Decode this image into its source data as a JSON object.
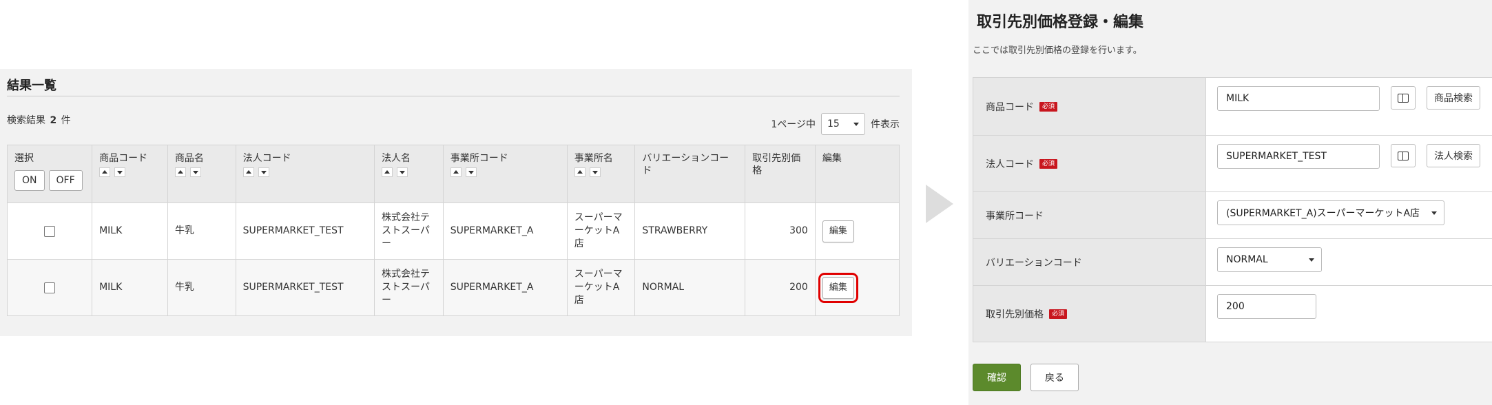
{
  "list": {
    "title": "結果一覧",
    "count_label": "検索結果",
    "count_value": "2",
    "count_unit": "件",
    "per_page_prefix": "1ページ中",
    "per_page_value": "15",
    "per_page_suffix": "件表示",
    "columns": {
      "select": "選択",
      "product_code": "商品コード",
      "product_name": "商品名",
      "corp_code": "法人コード",
      "corp_name": "法人名",
      "office_code": "事業所コード",
      "office_name": "事業所名",
      "variation_code": "バリエーションコード",
      "price": "取引先別価格",
      "edit": "編集"
    },
    "on_label": "ON",
    "off_label": "OFF",
    "edit_label": "編集",
    "rows": [
      {
        "product_code": "MILK",
        "product_name": "牛乳",
        "corp_code": "SUPERMARKET_TEST",
        "corp_name": "株式会社テストスーパー",
        "office_code": "SUPERMARKET_A",
        "office_name": "スーパーマーケットA店",
        "variation_code": "STRAWBERRY",
        "price": "300"
      },
      {
        "product_code": "MILK",
        "product_name": "牛乳",
        "corp_code": "SUPERMARKET_TEST",
        "corp_name": "株式会社テストスーパー",
        "office_code": "SUPERMARKET_A",
        "office_name": "スーパーマーケットA店",
        "variation_code": "NORMAL",
        "price": "200"
      }
    ]
  },
  "form": {
    "title": "取引先別価格登録・編集",
    "description": "ここでは取引先別価格の登録を行います。",
    "required_badge": "必須",
    "product_code_label": "商品コード",
    "product_code_value": "MILK",
    "product_search_label": "商品検索",
    "corp_code_label": "法人コード",
    "corp_code_value": "SUPERMARKET_TEST",
    "corp_search_label": "法人検索",
    "office_code_label": "事業所コード",
    "office_code_value": "(SUPERMARKET_A)スーパーマーケットA店",
    "variation_code_label": "バリエーションコード",
    "variation_code_value": "NORMAL",
    "price_label": "取引先別価格",
    "price_value": "200",
    "confirm_label": "確認",
    "back_label": "戻る"
  },
  "colors": {
    "confirm_button": "#5c8a2c",
    "required_badge": "#c8161e",
    "highlight": "#e00000"
  }
}
